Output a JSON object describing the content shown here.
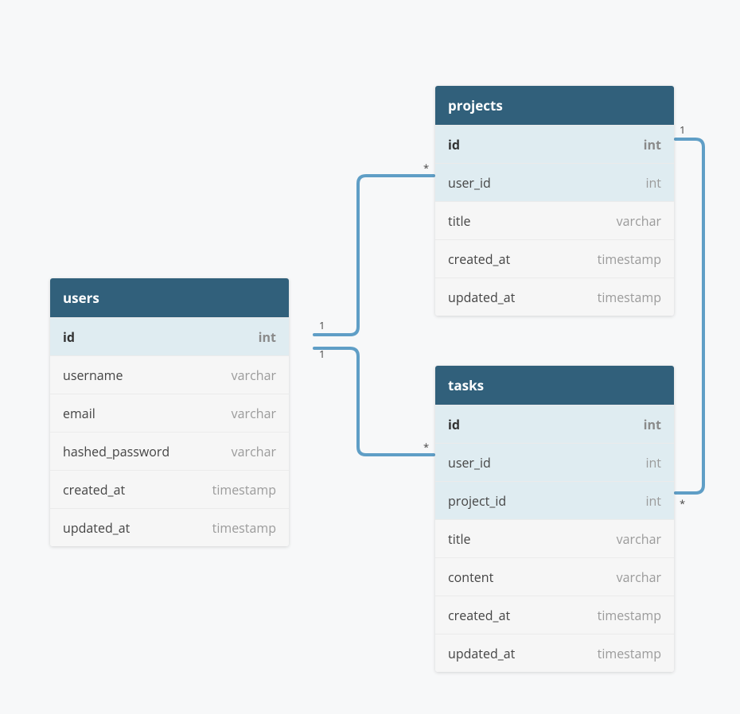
{
  "tables": {
    "users": {
      "title": "users",
      "columns": [
        {
          "name": "id",
          "type": "int",
          "pk": true
        },
        {
          "name": "username",
          "type": "varchar"
        },
        {
          "name": "email",
          "type": "varchar"
        },
        {
          "name": "hashed_password",
          "type": "varchar"
        },
        {
          "name": "created_at",
          "type": "timestamp"
        },
        {
          "name": "updated_at",
          "type": "timestamp"
        }
      ]
    },
    "projects": {
      "title": "projects",
      "columns": [
        {
          "name": "id",
          "type": "int",
          "pk": true
        },
        {
          "name": "user_id",
          "type": "int",
          "fk": true
        },
        {
          "name": "title",
          "type": "varchar"
        },
        {
          "name": "created_at",
          "type": "timestamp"
        },
        {
          "name": "updated_at",
          "type": "timestamp"
        }
      ]
    },
    "tasks": {
      "title": "tasks",
      "columns": [
        {
          "name": "id",
          "type": "int",
          "pk": true
        },
        {
          "name": "user_id",
          "type": "int",
          "fk": true
        },
        {
          "name": "project_id",
          "type": "int",
          "fk": true
        },
        {
          "name": "title",
          "type": "varchar"
        },
        {
          "name": "content",
          "type": "varchar"
        },
        {
          "name": "created_at",
          "type": "timestamp"
        },
        {
          "name": "updated_at",
          "type": "timestamp"
        }
      ]
    }
  },
  "relations": [
    {
      "from": "users.id",
      "to": "projects.user_id",
      "from_card": "1",
      "to_card": "*"
    },
    {
      "from": "users.id",
      "to": "tasks.user_id",
      "from_card": "1",
      "to_card": "*"
    },
    {
      "from": "projects.id",
      "to": "tasks.project_id",
      "from_card": "1",
      "to_card": "*"
    }
  ],
  "labels": {
    "one": "1",
    "many": "*"
  }
}
